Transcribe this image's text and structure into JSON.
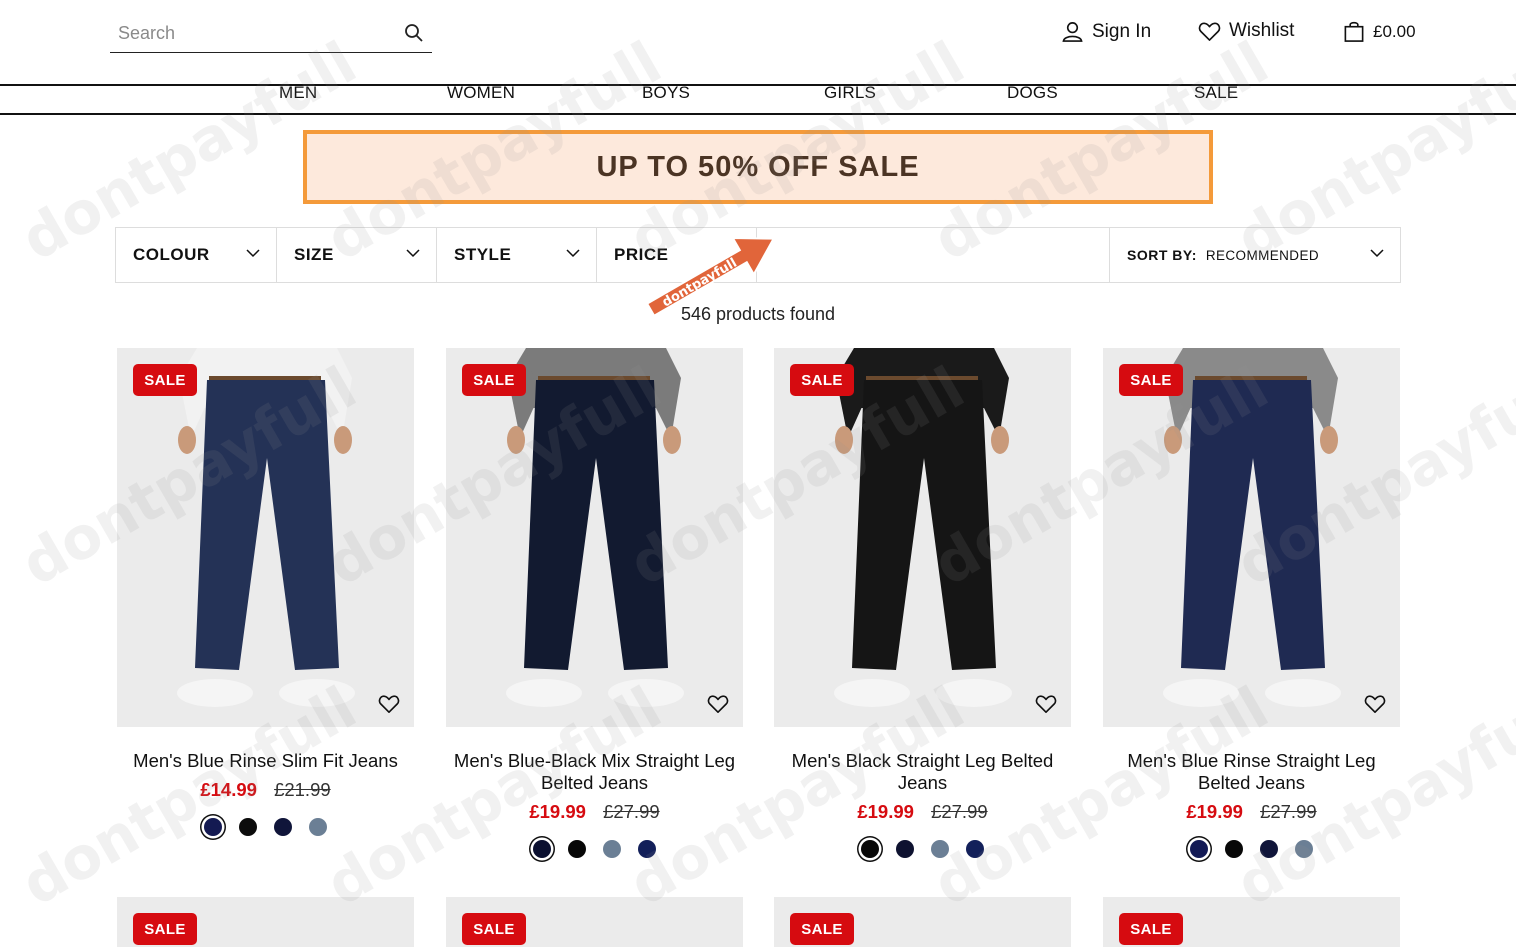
{
  "header": {
    "search_placeholder": "Search",
    "sign_in": "Sign In",
    "wishlist": "Wishlist",
    "basket_total": "£0.00"
  },
  "nav": [
    "MEN",
    "WOMEN",
    "BOYS",
    "GIRLS",
    "DOGS",
    "SALE"
  ],
  "banner": {
    "text": "UP TO 50% OFF SALE",
    "bg_color": "#fde9dc",
    "border_color": "#f49a3a"
  },
  "filters": {
    "colour": "COLOUR",
    "size": "SIZE",
    "style": "STYLE",
    "price": "PRICE",
    "sort_label": "SORT BY:",
    "sort_value": "RECOMMENDED"
  },
  "results": {
    "count_text": "546 products found"
  },
  "watermark": {
    "text": "dontpayfull"
  },
  "products": [
    {
      "badge": "SALE",
      "title": "Men's Blue Rinse Slim Fit Jeans",
      "price_now": "£14.99",
      "price_was": "£21.99",
      "swatches": [
        "#141a52",
        "#0c0c0c",
        "#10153a",
        "#6b7f95"
      ],
      "jeans_color": "#243256",
      "top_color": "#f2f2f2"
    },
    {
      "badge": "SALE",
      "title": "Men's Blue-Black Mix Straight Leg Belted Jeans",
      "price_now": "£19.99",
      "price_was": "£27.99",
      "swatches": [
        "#0b1030",
        "#070707",
        "#6b7f95",
        "#13205a"
      ],
      "jeans_color": "#121a30",
      "top_color": "#7b7b7b"
    },
    {
      "badge": "SALE",
      "title": "Men's Black Straight Leg Belted Jeans",
      "price_now": "£19.99",
      "price_was": "£27.99",
      "swatches": [
        "#080808",
        "#0e1230",
        "#6b7f95",
        "#13205a"
      ],
      "jeans_color": "#151515",
      "top_color": "#1a1a1a"
    },
    {
      "badge": "SALE",
      "title": "Men's Blue Rinse Straight Leg Belted Jeans",
      "price_now": "£19.99",
      "price_was": "£27.99",
      "swatches": [
        "#131a55",
        "#080808",
        "#10153a",
        "#6b7f95"
      ],
      "jeans_color": "#1f2a52",
      "top_color": "#8a8a8a"
    }
  ],
  "products_row2": [
    {
      "badge": "SALE"
    },
    {
      "badge": "SALE"
    },
    {
      "badge": "SALE"
    },
    {
      "badge": "SALE"
    }
  ],
  "colors": {
    "sale_red": "#d60b10",
    "accent_orange": "#f49a3a"
  }
}
